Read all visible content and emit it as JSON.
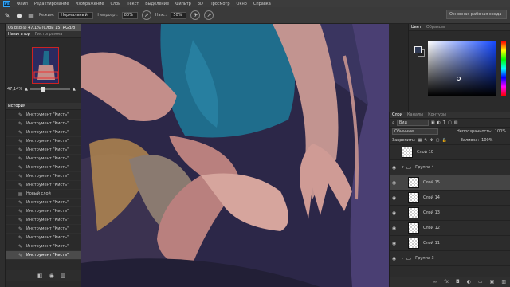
{
  "menubar": {
    "logo": "Ps",
    "items": [
      "Файл",
      "Редактирование",
      "Изображение",
      "Слои",
      "Текст",
      "Выделение",
      "Фильтр",
      "3D",
      "Просмотр",
      "Окно",
      "Справка"
    ]
  },
  "options": {
    "mode_label": "Режим:",
    "mode_value": "Нормальный",
    "opacity_label": "Непрозр.:",
    "opacity_value": "80%",
    "flow_label": "Наж.:",
    "flow_value": "50%",
    "workspace": "Основная рабочая среда"
  },
  "document": {
    "tab_title": "06.psd @ 47,1% (Слой 15, RGB/8)"
  },
  "navigator": {
    "tab_active": "Навигатор",
    "tab_other": "Гистограмма",
    "zoom": "47,14%"
  },
  "history": {
    "title": "История",
    "items": [
      {
        "icon": "brush",
        "label": "Инструмент \"Кисть\""
      },
      {
        "icon": "brush",
        "label": "Инструмент \"Кисть\""
      },
      {
        "icon": "brush",
        "label": "Инструмент \"Кисть\""
      },
      {
        "icon": "brush",
        "label": "Инструмент \"Кисть\""
      },
      {
        "icon": "brush",
        "label": "Инструмент \"Кисть\""
      },
      {
        "icon": "brush",
        "label": "Инструмент \"Кисть\""
      },
      {
        "icon": "brush",
        "label": "Инструмент \"Кисть\""
      },
      {
        "icon": "brush",
        "label": "Инструмент \"Кисть\""
      },
      {
        "icon": "brush",
        "label": "Инструмент \"Кисть\""
      },
      {
        "icon": "layer",
        "label": "Новый слой"
      },
      {
        "icon": "brush",
        "label": "Инструмент \"Кисть\""
      },
      {
        "icon": "brush",
        "label": "Инструмент \"Кисть\""
      },
      {
        "icon": "brush",
        "label": "Инструмент \"Кисть\""
      },
      {
        "icon": "brush",
        "label": "Инструмент \"Кисть\""
      },
      {
        "icon": "brush",
        "label": "Инструмент \"Кисть\""
      },
      {
        "icon": "brush",
        "label": "Инструмент \"Кисть\""
      },
      {
        "icon": "brush",
        "label": "Инструмент \"Кисть\""
      }
    ]
  },
  "color": {
    "tab_active": "Цвет",
    "tab_other": "Образцы",
    "foreground": "#2f3a55"
  },
  "layers": {
    "tabs": [
      "Слои",
      "Каналы",
      "Контуры"
    ],
    "filter_kind": "Вид",
    "blend_mode": "Обычные",
    "opacity_label": "Непрозрачность:",
    "opacity_value": "100%",
    "lock_label": "Закрепить:",
    "fill_label": "Заливка:",
    "fill_value": "100%",
    "rows": [
      {
        "name": "Слой 10",
        "visible": false,
        "selected": false,
        "group": false,
        "indent": false
      },
      {
        "name": "Группа 4",
        "visible": true,
        "selected": false,
        "group": true,
        "indent": false
      },
      {
        "name": "Слой 15",
        "visible": true,
        "selected": true,
        "group": false,
        "indent": true
      },
      {
        "name": "Слой 14",
        "visible": true,
        "selected": false,
        "group": false,
        "indent": true
      },
      {
        "name": "Слой 13",
        "visible": true,
        "selected": false,
        "group": false,
        "indent": true
      },
      {
        "name": "Слой 12",
        "visible": true,
        "selected": false,
        "group": false,
        "indent": true
      },
      {
        "name": "Слой 11",
        "visible": true,
        "selected": false,
        "group": false,
        "indent": true
      },
      {
        "name": "Группа 3",
        "visible": true,
        "selected": false,
        "group": true,
        "indent": false
      }
    ]
  }
}
